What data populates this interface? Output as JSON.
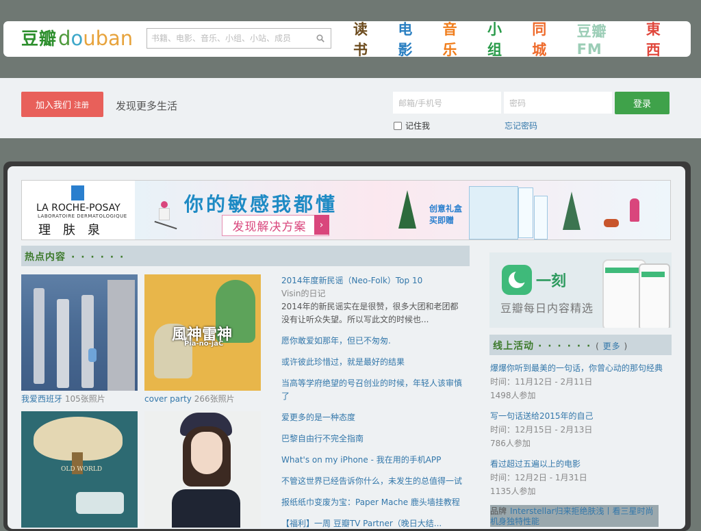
{
  "header": {
    "logo_cn": "豆瓣",
    "logo_en_a": "d",
    "logo_en_b": "o",
    "logo_en_c": "uban",
    "search_placeholder": "书籍、电影、音乐、小组、小站、成员",
    "nav": [
      {
        "label": "读书",
        "color": "#6b4a1c"
      },
      {
        "label": "电影",
        "color": "#2a7fc1"
      },
      {
        "label": "音乐",
        "color": "#f07d1b"
      },
      {
        "label": "小组",
        "color": "#2a9b4a"
      },
      {
        "label": "同城",
        "color": "#ee6a2a"
      },
      {
        "label": "豆瓣FM",
        "color": "#9bcdb6"
      },
      {
        "label": "東西",
        "color": "#e0473c"
      }
    ]
  },
  "login": {
    "join_label": "加入我们",
    "register_label": "注册",
    "discover": "发现更多生活",
    "email_placeholder": "邮箱/手机号",
    "password_placeholder": "密码",
    "login_button": "登录",
    "remember": "记住我",
    "forgot": "忘记密码"
  },
  "ad": {
    "brand": "LA ROCHE-POSAY",
    "brand_sub": "LABORATOIRE DERMATOLOGIQUE",
    "brand_cn": "理肤泉",
    "slogan": "你的敏感我都懂",
    "cta": "发现解决方案",
    "gift_line1": "创意礼盒",
    "gift_line2": "买即赠"
  },
  "hot": {
    "title": "热点内容",
    "dots": "· · · · · ·",
    "albums": [
      {
        "title": "我爱西班牙",
        "count": "105张照片"
      },
      {
        "title": "cover party",
        "count": "266张照片"
      },
      {
        "title": "",
        "count": ""
      },
      {
        "title": "",
        "count": ""
      }
    ],
    "album_overlay_title": "風神雷神",
    "album_overlay_sub": "Pia-no-jaC",
    "map_overlay": "OLD WORLD",
    "featured": {
      "title": "2014年度新民谣（Neo-Folk）Top 10",
      "author": "Visin的日记",
      "excerpt": "2014年的新民谣实在是很赞，很多大团和老团都没有让听众失望。所以写此文的时候也..."
    },
    "links": [
      "愿你敢爱如那年，但已不匆匆.",
      "或许彼此珍惜过，就是最好的结果",
      "当高等学府绝望的号召创业的时候，年轻人该审慎了",
      "爱更多的是一种态度",
      "巴黎自由行不完全指南",
      "What's on my iPhone - 我在用的手机APP",
      "不管这世界已经告诉你什么，未发生的总值得一试",
      "报纸纸巾变废为宝：Paper Mache 鹿头墙挂教程",
      "【福利】一周 豆瓣TV Partner（晚日大结..."
    ]
  },
  "side": {
    "app_name": "一刻",
    "app_slogan": "豆瓣每日内容精选",
    "activities_title": "线上活动",
    "dots": "· · · · · ·",
    "more": "更多",
    "activities": [
      {
        "title": "爆爆你听到最美的一句话，你曾心动的那句经典",
        "time": "时间：11月12日 - 2月11日",
        "count": "1498人参加"
      },
      {
        "title": "写一句话送给2015年的自己",
        "time": "时间：12月15日 - 2月13日",
        "count": "786人参加"
      },
      {
        "title": "看过超过五遍以上的电影",
        "time": "时间：12月2日 - 1月31日",
        "count": "1135人参加"
      }
    ],
    "ad_tag": "品牌",
    "ad_text": "Interstellar归来拒绝肤浅丨看三星时尚机身独特性能"
  }
}
